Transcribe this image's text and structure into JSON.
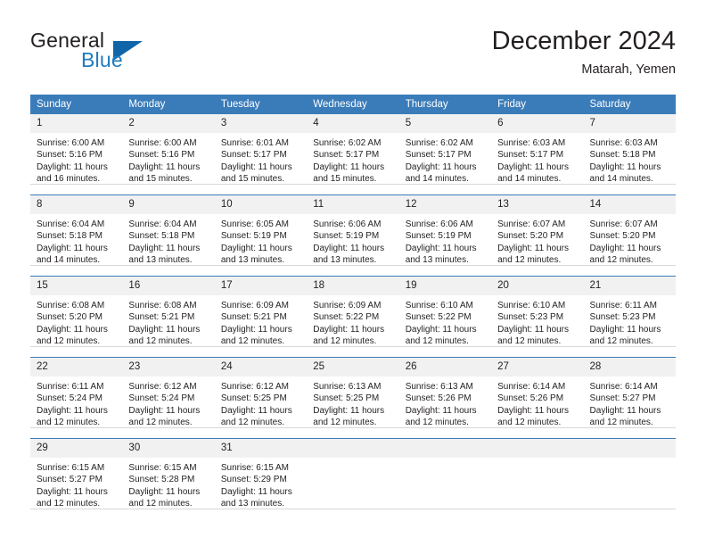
{
  "brand": {
    "name_part1": "General",
    "name_part2": "Blue",
    "flag_icon": "blue-triangle-flag-icon"
  },
  "header": {
    "title": "December 2024",
    "subtitle": "Matarah, Yemen"
  },
  "colors": {
    "header_blue": "#3a7cb9",
    "daynum_gray": "#f1f1f1",
    "logo_blue": "#1f7bc1",
    "flag_blue": "#1065a8",
    "text": "#231f20"
  },
  "weekdays": [
    "Sunday",
    "Monday",
    "Tuesday",
    "Wednesday",
    "Thursday",
    "Friday",
    "Saturday"
  ],
  "weeks": [
    [
      {
        "day": "1",
        "sunrise": "Sunrise: 6:00 AM",
        "sunset": "Sunset: 5:16 PM",
        "daylight1": "Daylight: 11 hours",
        "daylight2": "and 16 minutes."
      },
      {
        "day": "2",
        "sunrise": "Sunrise: 6:00 AM",
        "sunset": "Sunset: 5:16 PM",
        "daylight1": "Daylight: 11 hours",
        "daylight2": "and 15 minutes."
      },
      {
        "day": "3",
        "sunrise": "Sunrise: 6:01 AM",
        "sunset": "Sunset: 5:17 PM",
        "daylight1": "Daylight: 11 hours",
        "daylight2": "and 15 minutes."
      },
      {
        "day": "4",
        "sunrise": "Sunrise: 6:02 AM",
        "sunset": "Sunset: 5:17 PM",
        "daylight1": "Daylight: 11 hours",
        "daylight2": "and 15 minutes."
      },
      {
        "day": "5",
        "sunrise": "Sunrise: 6:02 AM",
        "sunset": "Sunset: 5:17 PM",
        "daylight1": "Daylight: 11 hours",
        "daylight2": "and 14 minutes."
      },
      {
        "day": "6",
        "sunrise": "Sunrise: 6:03 AM",
        "sunset": "Sunset: 5:17 PM",
        "daylight1": "Daylight: 11 hours",
        "daylight2": "and 14 minutes."
      },
      {
        "day": "7",
        "sunrise": "Sunrise: 6:03 AM",
        "sunset": "Sunset: 5:18 PM",
        "daylight1": "Daylight: 11 hours",
        "daylight2": "and 14 minutes."
      }
    ],
    [
      {
        "day": "8",
        "sunrise": "Sunrise: 6:04 AM",
        "sunset": "Sunset: 5:18 PM",
        "daylight1": "Daylight: 11 hours",
        "daylight2": "and 14 minutes."
      },
      {
        "day": "9",
        "sunrise": "Sunrise: 6:04 AM",
        "sunset": "Sunset: 5:18 PM",
        "daylight1": "Daylight: 11 hours",
        "daylight2": "and 13 minutes."
      },
      {
        "day": "10",
        "sunrise": "Sunrise: 6:05 AM",
        "sunset": "Sunset: 5:19 PM",
        "daylight1": "Daylight: 11 hours",
        "daylight2": "and 13 minutes."
      },
      {
        "day": "11",
        "sunrise": "Sunrise: 6:06 AM",
        "sunset": "Sunset: 5:19 PM",
        "daylight1": "Daylight: 11 hours",
        "daylight2": "and 13 minutes."
      },
      {
        "day": "12",
        "sunrise": "Sunrise: 6:06 AM",
        "sunset": "Sunset: 5:19 PM",
        "daylight1": "Daylight: 11 hours",
        "daylight2": "and 13 minutes."
      },
      {
        "day": "13",
        "sunrise": "Sunrise: 6:07 AM",
        "sunset": "Sunset: 5:20 PM",
        "daylight1": "Daylight: 11 hours",
        "daylight2": "and 12 minutes."
      },
      {
        "day": "14",
        "sunrise": "Sunrise: 6:07 AM",
        "sunset": "Sunset: 5:20 PM",
        "daylight1": "Daylight: 11 hours",
        "daylight2": "and 12 minutes."
      }
    ],
    [
      {
        "day": "15",
        "sunrise": "Sunrise: 6:08 AM",
        "sunset": "Sunset: 5:20 PM",
        "daylight1": "Daylight: 11 hours",
        "daylight2": "and 12 minutes."
      },
      {
        "day": "16",
        "sunrise": "Sunrise: 6:08 AM",
        "sunset": "Sunset: 5:21 PM",
        "daylight1": "Daylight: 11 hours",
        "daylight2": "and 12 minutes."
      },
      {
        "day": "17",
        "sunrise": "Sunrise: 6:09 AM",
        "sunset": "Sunset: 5:21 PM",
        "daylight1": "Daylight: 11 hours",
        "daylight2": "and 12 minutes."
      },
      {
        "day": "18",
        "sunrise": "Sunrise: 6:09 AM",
        "sunset": "Sunset: 5:22 PM",
        "daylight1": "Daylight: 11 hours",
        "daylight2": "and 12 minutes."
      },
      {
        "day": "19",
        "sunrise": "Sunrise: 6:10 AM",
        "sunset": "Sunset: 5:22 PM",
        "daylight1": "Daylight: 11 hours",
        "daylight2": "and 12 minutes."
      },
      {
        "day": "20",
        "sunrise": "Sunrise: 6:10 AM",
        "sunset": "Sunset: 5:23 PM",
        "daylight1": "Daylight: 11 hours",
        "daylight2": "and 12 minutes."
      },
      {
        "day": "21",
        "sunrise": "Sunrise: 6:11 AM",
        "sunset": "Sunset: 5:23 PM",
        "daylight1": "Daylight: 11 hours",
        "daylight2": "and 12 minutes."
      }
    ],
    [
      {
        "day": "22",
        "sunrise": "Sunrise: 6:11 AM",
        "sunset": "Sunset: 5:24 PM",
        "daylight1": "Daylight: 11 hours",
        "daylight2": "and 12 minutes."
      },
      {
        "day": "23",
        "sunrise": "Sunrise: 6:12 AM",
        "sunset": "Sunset: 5:24 PM",
        "daylight1": "Daylight: 11 hours",
        "daylight2": "and 12 minutes."
      },
      {
        "day": "24",
        "sunrise": "Sunrise: 6:12 AM",
        "sunset": "Sunset: 5:25 PM",
        "daylight1": "Daylight: 11 hours",
        "daylight2": "and 12 minutes."
      },
      {
        "day": "25",
        "sunrise": "Sunrise: 6:13 AM",
        "sunset": "Sunset: 5:25 PM",
        "daylight1": "Daylight: 11 hours",
        "daylight2": "and 12 minutes."
      },
      {
        "day": "26",
        "sunrise": "Sunrise: 6:13 AM",
        "sunset": "Sunset: 5:26 PM",
        "daylight1": "Daylight: 11 hours",
        "daylight2": "and 12 minutes."
      },
      {
        "day": "27",
        "sunrise": "Sunrise: 6:14 AM",
        "sunset": "Sunset: 5:26 PM",
        "daylight1": "Daylight: 11 hours",
        "daylight2": "and 12 minutes."
      },
      {
        "day": "28",
        "sunrise": "Sunrise: 6:14 AM",
        "sunset": "Sunset: 5:27 PM",
        "daylight1": "Daylight: 11 hours",
        "daylight2": "and 12 minutes."
      }
    ],
    [
      {
        "day": "29",
        "sunrise": "Sunrise: 6:15 AM",
        "sunset": "Sunset: 5:27 PM",
        "daylight1": "Daylight: 11 hours",
        "daylight2": "and 12 minutes."
      },
      {
        "day": "30",
        "sunrise": "Sunrise: 6:15 AM",
        "sunset": "Sunset: 5:28 PM",
        "daylight1": "Daylight: 11 hours",
        "daylight2": "and 12 minutes."
      },
      {
        "day": "31",
        "sunrise": "Sunrise: 6:15 AM",
        "sunset": "Sunset: 5:29 PM",
        "daylight1": "Daylight: 11 hours",
        "daylight2": "and 13 minutes."
      },
      {
        "day": "",
        "sunrise": "",
        "sunset": "",
        "daylight1": "",
        "daylight2": ""
      },
      {
        "day": "",
        "sunrise": "",
        "sunset": "",
        "daylight1": "",
        "daylight2": ""
      },
      {
        "day": "",
        "sunrise": "",
        "sunset": "",
        "daylight1": "",
        "daylight2": ""
      },
      {
        "day": "",
        "sunrise": "",
        "sunset": "",
        "daylight1": "",
        "daylight2": ""
      }
    ]
  ]
}
